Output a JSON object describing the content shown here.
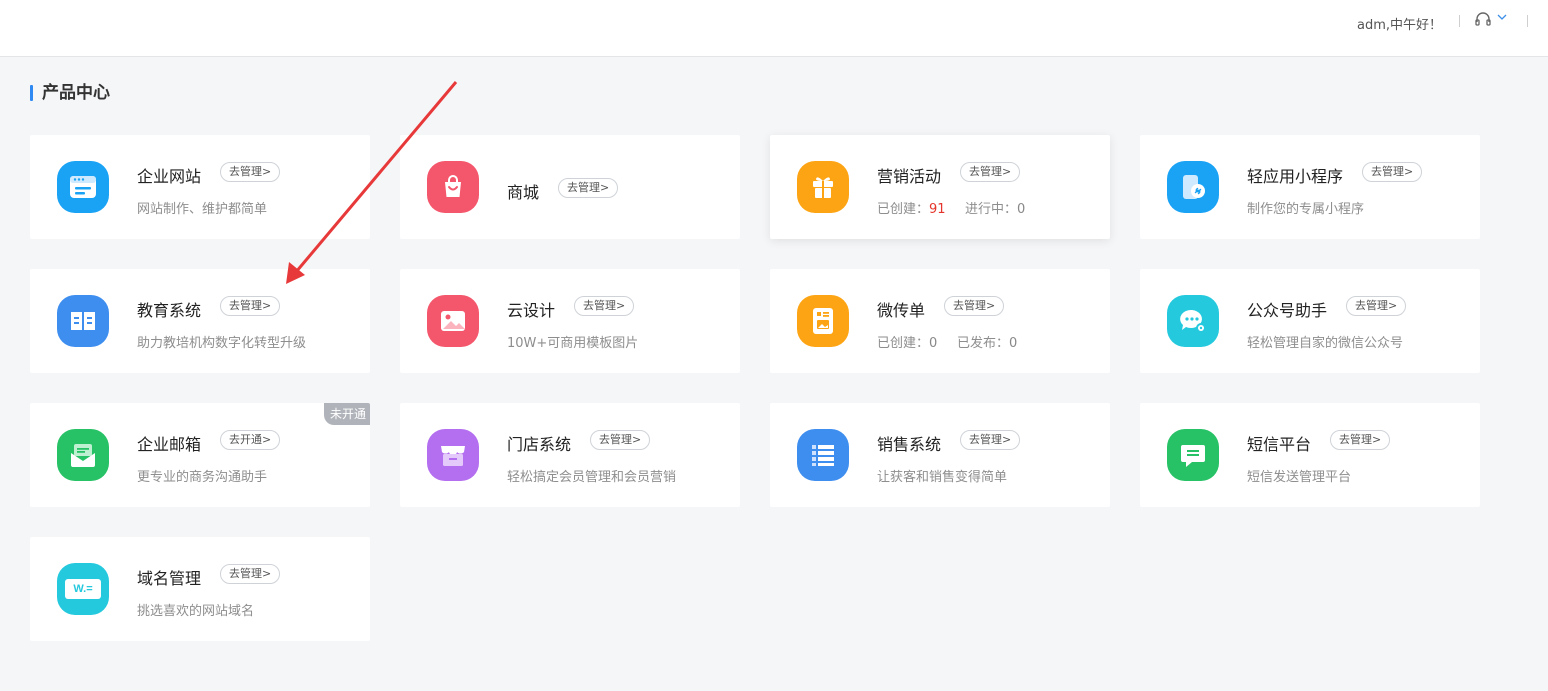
{
  "header": {
    "greeting": "adm,中午好！",
    "icons": [
      "headset-icon",
      "chevron-down-icon"
    ]
  },
  "section": {
    "title": "产品中心"
  },
  "cards": [
    {
      "title": "企业网站",
      "action": "去管理>",
      "desc": "网站制作、维护都简单",
      "icon": "website-icon",
      "color": "#1aa3f5"
    },
    {
      "title": "商城",
      "action": "去管理>",
      "desc": "",
      "icon": "shopping-bag-icon",
      "color": "#f4566b"
    },
    {
      "title": "营销活动",
      "action": "去管理>",
      "stats": [
        {
          "label": "已创建：",
          "value": "91"
        },
        {
          "label": "进行中：",
          "value": "0"
        }
      ],
      "icon": "gift-icon",
      "color": "#fda414"
    },
    {
      "title": "轻应用小程序",
      "action": "去管理>",
      "desc": "制作您的专属小程序",
      "icon": "mini-program-icon",
      "color": "#1aa3f5"
    },
    {
      "title": "教育系统",
      "action": "去管理>",
      "desc": "助力教培机构数字化转型升级",
      "icon": "book-icon",
      "color": "#3e8ef0"
    },
    {
      "title": "云设计",
      "action": "去管理>",
      "desc": "10W+可商用模板图片",
      "icon": "image-icon",
      "color": "#f4566b"
    },
    {
      "title": "微传单",
      "action": "去管理>",
      "stats": [
        {
          "label": "已创建：",
          "value": "0"
        },
        {
          "label": "已发布：",
          "value": "0"
        }
      ],
      "icon": "flyer-icon",
      "color": "#fda414"
    },
    {
      "title": "公众号助手",
      "action": "去管理>",
      "desc": "轻松管理自家的微信公众号",
      "icon": "chat-gear-icon",
      "color": "#25c9de"
    },
    {
      "title": "企业邮箱",
      "action": "去开通>",
      "desc": "更专业的商务沟通助手",
      "icon": "mail-icon",
      "color": "#27c266",
      "badge": "未开通"
    },
    {
      "title": "门店系统",
      "action": "去管理>",
      "desc": "轻松搞定会员管理和会员营销",
      "icon": "store-icon",
      "color": "#b46ef0"
    },
    {
      "title": "销售系统",
      "action": "去管理>",
      "desc": "让获客和销售变得简单",
      "icon": "list-icon",
      "color": "#3e8ef0"
    },
    {
      "title": "短信平台",
      "action": "去管理>",
      "desc": "短信发送管理平台",
      "icon": "sms-icon",
      "color": "#27c266"
    },
    {
      "title": "域名管理",
      "action": "去管理>",
      "desc": "挑选喜欢的网站域名",
      "icon": "domain-icon",
      "color": "#25c9de",
      "icon_text": "W.="
    }
  ],
  "annotation": {
    "icon": "red-arrow-icon",
    "color": "#e8393a"
  }
}
